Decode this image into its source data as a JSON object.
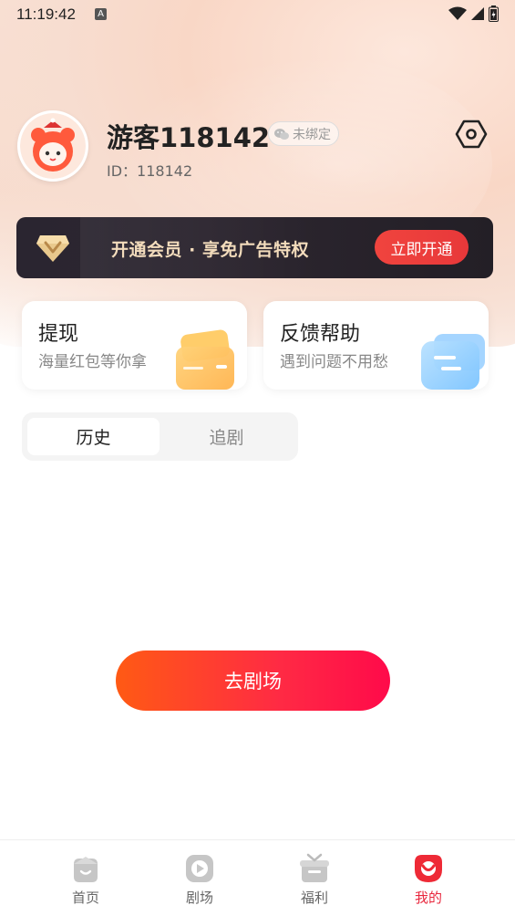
{
  "status_bar": {
    "time": "11:19:42",
    "notif_letter": "A"
  },
  "profile": {
    "username": "游客118142",
    "bind_status": "未绑定",
    "user_id": "ID：118142"
  },
  "vip_banner": {
    "text": "开通会员 · 享免广告特权",
    "button_label": "立即开通"
  },
  "cards": [
    {
      "title": "提现",
      "subtitle": "海量红包等你拿"
    },
    {
      "title": "反馈帮助",
      "subtitle": "遇到问题不用愁"
    }
  ],
  "tabs": [
    {
      "label": "历史",
      "active": true
    },
    {
      "label": "追剧",
      "active": false
    }
  ],
  "go_button_label": "去剧场",
  "bottom_nav": [
    {
      "label": "首页",
      "icon": "home-icon"
    },
    {
      "label": "剧场",
      "icon": "theater-play-icon"
    },
    {
      "label": "福利",
      "icon": "gift-icon"
    },
    {
      "label": "我的",
      "icon": "profile-icon",
      "active": true
    }
  ],
  "colors": {
    "accent": "#e8283e",
    "vip_gold": "#f3dcbc",
    "vip_button": "#f0443e"
  }
}
